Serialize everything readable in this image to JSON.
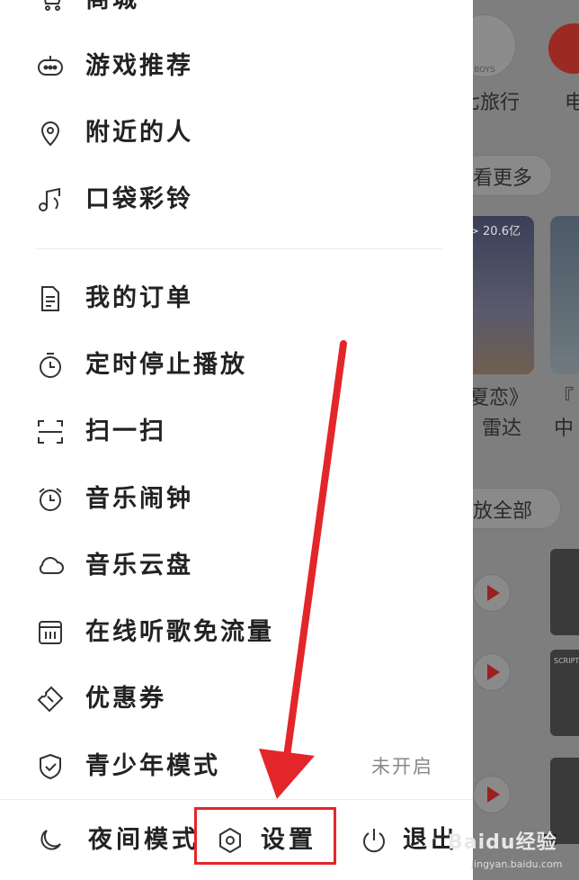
{
  "background_app": {
    "texts": [
      "七旅行",
      "看更多",
      "夏恋》",
      "雷达",
      "『",
      "中",
      "放全部",
      "电"
    ],
    "card_count": "> 20.6亿",
    "circle_label": "BOYS",
    "thumb_label": "SCRIPT"
  },
  "drawer": {
    "partial_top_item": "商城",
    "items": [
      {
        "label": "游戏推荐",
        "icon": "gamepad-icon"
      },
      {
        "label": "附近的人",
        "icon": "location-pin-icon"
      },
      {
        "label": "口袋彩铃",
        "icon": "music-note-icon"
      },
      {
        "label": "我的订单",
        "icon": "document-icon"
      },
      {
        "label": "定时停止播放",
        "icon": "timer-icon"
      },
      {
        "label": "扫一扫",
        "icon": "scan-icon"
      },
      {
        "label": "音乐闹钟",
        "icon": "alarm-clock-icon"
      },
      {
        "label": "音乐云盘",
        "icon": "cloud-icon"
      },
      {
        "label": "在线听歌免流量",
        "icon": "data-plan-icon"
      },
      {
        "label": "优惠券",
        "icon": "coupon-icon"
      },
      {
        "label": "青少年模式",
        "icon": "shield-icon",
        "status": "未开启"
      }
    ]
  },
  "bottom_bar": {
    "night_mode": "夜间模式",
    "settings": "设置",
    "exit": "退出"
  },
  "annotation": {
    "highlight_color": "#e3262a"
  },
  "watermark": {
    "line1": "Baidu经验",
    "line2": "jingyan.baidu.com"
  }
}
